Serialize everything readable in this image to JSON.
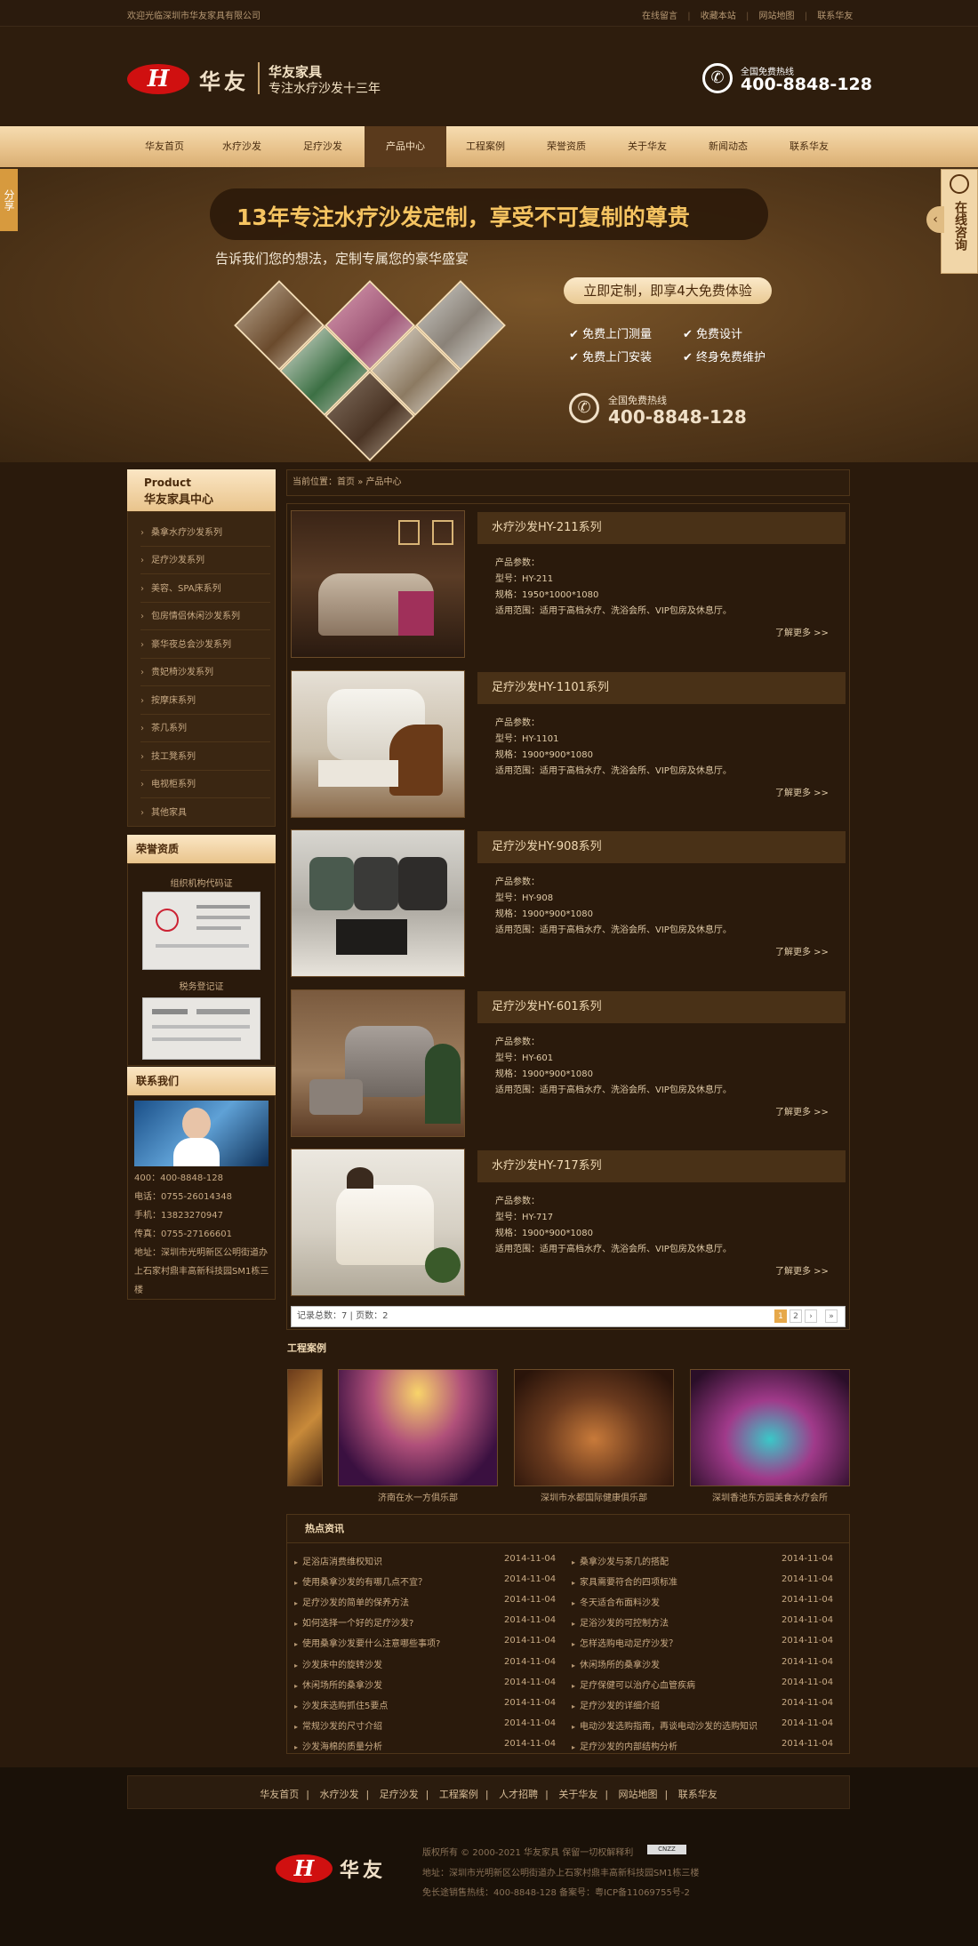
{
  "topbar": {
    "welcome": "欢迎光临深圳市华友家具有限公司",
    "links": [
      "在线留言",
      "收藏本站",
      "网站地图",
      "联系华友"
    ]
  },
  "header": {
    "logo_letter": "H",
    "logo_name": "华友",
    "brand_title": "华友家具",
    "brand_slogan": "专注水疗沙发十三年",
    "phone_label": "全国免费热线",
    "phone_number": "400-8848-128"
  },
  "nav": {
    "items": [
      "华友首页",
      "水疗沙发",
      "足疗沙发",
      "产品中心",
      "工程案例",
      "荣誉资质",
      "关于华友",
      "新闻动态",
      "联系华友"
    ],
    "active_index": 3
  },
  "banner": {
    "headline": "13年专注水疗沙发定制，享受不可复制的尊贵",
    "subline": "告诉我们您的想法，定制专属您的豪华盛宴",
    "offer": "立即定制，即享4大免费体验",
    "features": [
      "免费上门测量",
      "免费设计",
      "免费上门安装",
      "终身免费维护"
    ],
    "hotline_label": "全国免费热线",
    "hotline_number": "400-8848-128"
  },
  "share_tab": "分享",
  "consult_tab": "在线咨询",
  "sidebar": {
    "category_en": "Product",
    "category_cn": "华友家具中心",
    "categories": [
      "桑拿水疗沙发系列",
      "足疗沙发系列",
      "美容、SPA床系列",
      "包房情侣休闲沙发系列",
      "豪华夜总会沙发系列",
      "贵妃椅沙发系列",
      "按摩床系列",
      "茶几系列",
      "技工凳系列",
      "电视柜系列",
      "其他家具"
    ],
    "honor_title": "荣誉资质",
    "certs": [
      "组织机构代码证",
      "税务登记证"
    ],
    "contact_title": "联系我们",
    "contact_lines": [
      "400：400-8848-128",
      "电话：0755-26014348",
      "手机：13823270947",
      "传真：0755-27166601",
      "地址：深圳市光明新区公明街道办上石家村鼎丰高新科技园SM1栋三楼"
    ]
  },
  "breadcrumb": {
    "prefix": "当前位置：",
    "home": "首页",
    "sep": "»",
    "current": "产品中心"
  },
  "products": [
    {
      "title": "水疗沙发HY-211系列",
      "params_label": "产品参数：",
      "model": "型号：HY-211",
      "size": "规格：1950*1000*1080",
      "scope": "适用范围：适用于高档水疗、洗浴会所、VIP包房及休息厅。",
      "more": "了解更多 >>"
    },
    {
      "title": "足疗沙发HY-1101系列",
      "params_label": "产品参数：",
      "model": "型号：HY-1101",
      "size": "规格：1900*900*1080",
      "scope": "适用范围：适用于高档水疗、洗浴会所、VIP包房及休息厅。",
      "more": "了解更多 >>"
    },
    {
      "title": "足疗沙发HY-908系列",
      "params_label": "产品参数：",
      "model": "型号：HY-908",
      "size": "规格：1900*900*1080",
      "scope": "适用范围：适用于高档水疗、洗浴会所、VIP包房及休息厅。",
      "more": "了解更多 >>"
    },
    {
      "title": "足疗沙发HY-601系列",
      "params_label": "产品参数：",
      "model": "型号：HY-601",
      "size": "规格：1900*900*1080",
      "scope": "适用范围：适用于高档水疗、洗浴会所、VIP包房及休息厅。",
      "more": "了解更多 >>"
    },
    {
      "title": "水疗沙发HY-717系列",
      "params_label": "产品参数：",
      "model": "型号：HY-717",
      "size": "规格：1900*900*1080",
      "scope": "适用范围：适用于高档水疗、洗浴会所、VIP包房及休息厅。",
      "more": "了解更多 >>"
    }
  ],
  "pager": {
    "summary": "记录总数：7 | 页数：2",
    "pages": [
      "1",
      "2",
      "›",
      "»"
    ],
    "current": "1"
  },
  "cases": {
    "title": "工程案例",
    "items": [
      "济南在水一方俱乐部",
      "深圳市水都国际健康俱乐部",
      "深圳香池东方园美食水疗会所"
    ]
  },
  "news": {
    "title": "热点资讯",
    "left": [
      {
        "t": "足浴店消费维权知识",
        "d": "2014-11-04"
      },
      {
        "t": "使用桑拿沙发的有哪几点不宜？",
        "d": "2014-11-04"
      },
      {
        "t": "足疗沙发的简单的保养方法",
        "d": "2014-11-04"
      },
      {
        "t": "如何选择一个好的足疗沙发?",
        "d": "2014-11-04"
      },
      {
        "t": "使用桑拿沙发要什么注意哪些事项?",
        "d": "2014-11-04"
      },
      {
        "t": "沙发床中的旋转沙发",
        "d": "2014-11-04"
      },
      {
        "t": "休闲场所的桑拿沙发",
        "d": "2014-11-04"
      },
      {
        "t": "沙发床选购抓住5要点",
        "d": "2014-11-04"
      },
      {
        "t": "常规沙发的尺寸介绍",
        "d": "2014-11-04"
      },
      {
        "t": "沙发海棉的质量分析",
        "d": "2014-11-04"
      }
    ],
    "right": [
      {
        "t": "桑拿沙发与茶几的搭配",
        "d": "2014-11-04"
      },
      {
        "t": "家具需要符合的四项标准",
        "d": "2014-11-04"
      },
      {
        "t": "冬天适合布面料沙发",
        "d": "2014-11-04"
      },
      {
        "t": "足浴沙发的可控制方法",
        "d": "2014-11-04"
      },
      {
        "t": "怎样选购电动足疗沙发？",
        "d": "2014-11-04"
      },
      {
        "t": "休闲场所的桑拿沙发",
        "d": "2014-11-04"
      },
      {
        "t": "足疗保健可以治疗心血管疾病",
        "d": "2014-11-04"
      },
      {
        "t": "足疗沙发的详细介绍",
        "d": "2014-11-04"
      },
      {
        "t": "电动沙发选购指南，再谈电动沙发的选购知识",
        "d": "2014-11-04"
      },
      {
        "t": "足疗沙发的内部结构分析",
        "d": "2014-11-04"
      }
    ]
  },
  "footer": {
    "links": [
      "华友首页",
      "水疗沙发",
      "足疗沙发",
      "工程案例",
      "人才招聘",
      "关于华友",
      "网站地图",
      "联系华友"
    ],
    "logo_letter": "H",
    "logo_name": "华友",
    "copyright": "版权所有 © 2000-2021 华友家具 保留一切权解释利",
    "cnzz": "CNZZ",
    "address": "地址：深圳市光明新区公明街道办上石家村鼎丰高新科技园SM1栋三楼",
    "hotline": "免长途销售热线：400-8848-128 备案号：粤ICP备11069755号-2"
  },
  "colors": {
    "accent": "#e6a84a",
    "brand_red": "#d01010",
    "bg": "#2a1a0c"
  }
}
